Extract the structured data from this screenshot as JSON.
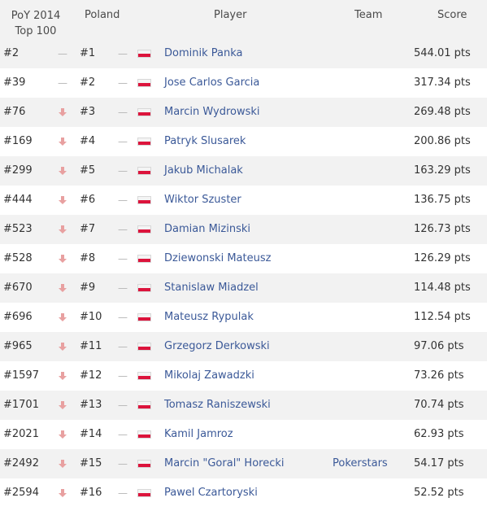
{
  "header": {
    "poy_line1": "PoY 2014",
    "poy_line2": "Top 100",
    "poland": "Poland",
    "player": "Player",
    "team": "Team",
    "score": "Score"
  },
  "colors": {
    "link": "#3b5998",
    "down_arrow": "#e8a0a0",
    "alt_row": "#f2f2f2"
  },
  "rows": [
    {
      "poy": "#2",
      "poy_change": "dash",
      "pos": "#1",
      "pos_change": "dash",
      "flag": "poland-flag",
      "name": "Dominik Panka",
      "team": "",
      "score": "544.01 pts"
    },
    {
      "poy": "#39",
      "poy_change": "dash",
      "pos": "#2",
      "pos_change": "dash",
      "flag": "poland-flag",
      "name": "Jose Carlos Garcia",
      "team": "",
      "score": "317.34 pts"
    },
    {
      "poy": "#76",
      "poy_change": "down",
      "pos": "#3",
      "pos_change": "dash",
      "flag": "poland-flag",
      "name": "Marcin Wydrowski",
      "team": "",
      "score": "269.48 pts"
    },
    {
      "poy": "#169",
      "poy_change": "down",
      "pos": "#4",
      "pos_change": "dash",
      "flag": "poland-flag",
      "name": "Patryk Slusarek",
      "team": "",
      "score": "200.86 pts"
    },
    {
      "poy": "#299",
      "poy_change": "down",
      "pos": "#5",
      "pos_change": "dash",
      "flag": "poland-flag",
      "name": "Jakub Michalak",
      "team": "",
      "score": "163.29 pts"
    },
    {
      "poy": "#444",
      "poy_change": "down",
      "pos": "#6",
      "pos_change": "dash",
      "flag": "poland-flag",
      "name": "Wiktor Szuster",
      "team": "",
      "score": "136.75 pts"
    },
    {
      "poy": "#523",
      "poy_change": "down",
      "pos": "#7",
      "pos_change": "dash",
      "flag": "poland-flag",
      "name": "Damian Mizinski",
      "team": "",
      "score": "126.73 pts"
    },
    {
      "poy": "#528",
      "poy_change": "down",
      "pos": "#8",
      "pos_change": "dash",
      "flag": "poland-flag",
      "name": "Dziewonski Mateusz",
      "team": "",
      "score": "126.29 pts"
    },
    {
      "poy": "#670",
      "poy_change": "down",
      "pos": "#9",
      "pos_change": "dash",
      "flag": "poland-flag",
      "name": "Stanislaw Miadzel",
      "team": "",
      "score": "114.48 pts"
    },
    {
      "poy": "#696",
      "poy_change": "down",
      "pos": "#10",
      "pos_change": "dash",
      "flag": "poland-flag",
      "name": "Mateusz Rypulak",
      "team": "",
      "score": "112.54 pts"
    },
    {
      "poy": "#965",
      "poy_change": "down",
      "pos": "#11",
      "pos_change": "dash",
      "flag": "poland-flag",
      "name": "Grzegorz Derkowski",
      "team": "",
      "score": "97.06 pts"
    },
    {
      "poy": "#1597",
      "poy_change": "down",
      "pos": "#12",
      "pos_change": "dash",
      "flag": "poland-flag",
      "name": "Mikolaj Zawadzki",
      "team": "",
      "score": "73.26 pts"
    },
    {
      "poy": "#1701",
      "poy_change": "down",
      "pos": "#13",
      "pos_change": "dash",
      "flag": "poland-flag",
      "name": "Tomasz Raniszewski",
      "team": "",
      "score": "70.74 pts"
    },
    {
      "poy": "#2021",
      "poy_change": "down",
      "pos": "#14",
      "pos_change": "dash",
      "flag": "poland-flag",
      "name": "Kamil Jamroz",
      "team": "",
      "score": "62.93 pts"
    },
    {
      "poy": "#2492",
      "poy_change": "down",
      "pos": "#15",
      "pos_change": "dash",
      "flag": "poland-flag",
      "name": "Marcin \"Goral\" Horecki",
      "team": "Pokerstars",
      "score": "54.17 pts"
    },
    {
      "poy": "#2594",
      "poy_change": "down",
      "pos": "#16",
      "pos_change": "dash",
      "flag": "poland-flag",
      "name": "Pawel Czartoryski",
      "team": "",
      "score": "52.52 pts"
    }
  ]
}
